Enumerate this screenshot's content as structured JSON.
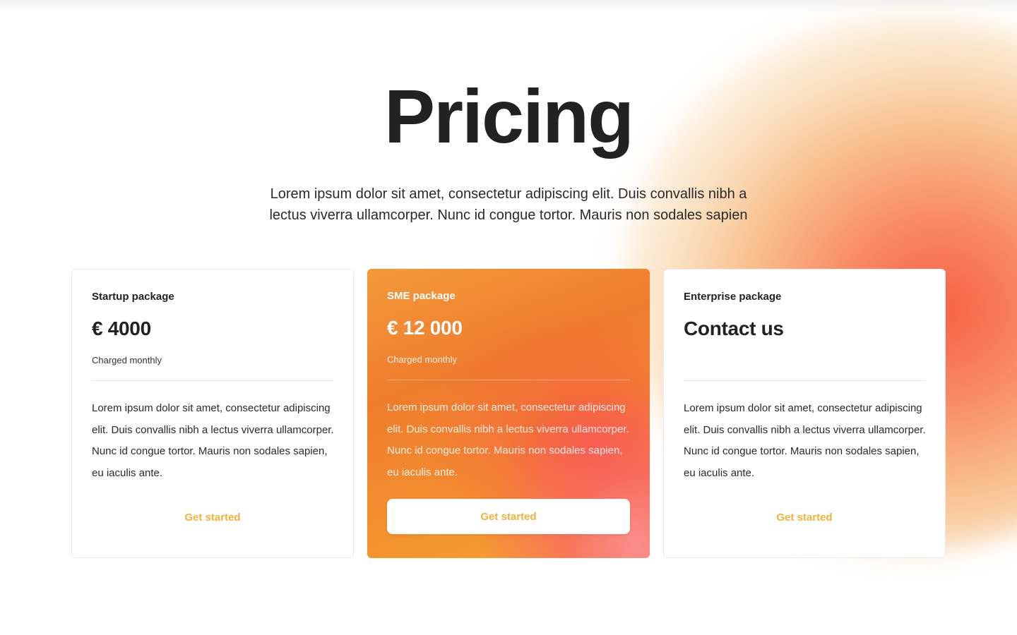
{
  "page": {
    "title": "Pricing",
    "subtitle": "Lorem ipsum dolor sit amet, consectetur adipiscing elit. Duis convallis nibh a lectus viverra ullamcorper. Nunc id congue tortor. Mauris non sodales sapien"
  },
  "colors": {
    "accent": "#f2b13d",
    "text": "#222222",
    "highlight_card_start": "#f39a3c",
    "highlight_card_end": "#f75a46"
  },
  "cards": [
    {
      "name": "Startup package",
      "price": "€ 4000",
      "billing": "Charged monthly",
      "description": "Lorem ipsum dolor sit amet, consectetur adipiscing elit. Duis convallis nibh a lectus viverra ullamcorper. Nunc id congue tortor. Mauris non sodales sapien, eu iaculis ante.",
      "cta": "Get started"
    },
    {
      "name": "SME package",
      "price": "€ 12 000",
      "billing": "Charged monthly",
      "description": "Lorem ipsum dolor sit amet, consectetur adipiscing elit. Duis convallis nibh a lectus viverra ullamcorper. Nunc id congue tortor. Mauris non sodales sapien, eu iaculis ante.",
      "cta": "Get started"
    },
    {
      "name": "Enterprise package",
      "price": "Contact us",
      "billing": "",
      "description": "Lorem ipsum dolor sit amet, consectetur adipiscing elit. Duis convallis nibh a lectus viverra ullamcorper. Nunc id congue tortor. Mauris non sodales sapien, eu iaculis ante.",
      "cta": "Get started"
    }
  ]
}
